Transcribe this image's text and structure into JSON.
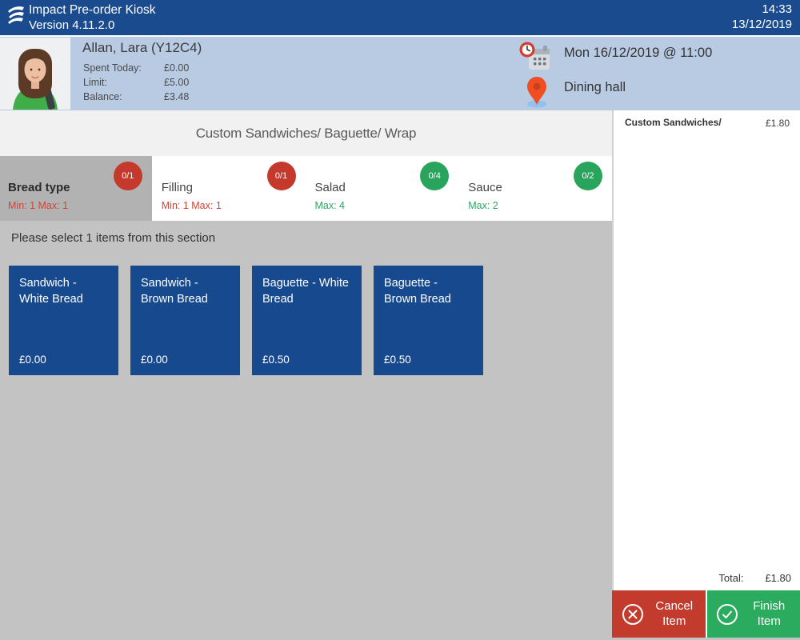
{
  "titlebar": {
    "app_title": "Impact Pre-order Kiosk",
    "version": "Version 4.11.2.0",
    "time": "14:33",
    "date": "13/12/2019"
  },
  "user": {
    "name": "Allan, Lara (Y12C4)",
    "stats": [
      {
        "label": "Spent Today:",
        "value": "£0.00"
      },
      {
        "label": "Limit:",
        "value": "£5.00"
      },
      {
        "label": "Balance:",
        "value": "£3.48"
      }
    ]
  },
  "session": {
    "datetime": "Mon 16/12/2019 @ 11:00",
    "location": "Dining hall"
  },
  "category_title": "Custom Sandwiches/ Baguette/ Wrap",
  "tabs": [
    {
      "label": "Bread type",
      "badge": "0/1",
      "constraint": "Min: 1 Max: 1",
      "status": "red",
      "selected": true
    },
    {
      "label": "Filling",
      "badge": "0/1",
      "constraint": "Min: 1 Max: 1",
      "status": "red",
      "selected": false
    },
    {
      "label": "Salad",
      "badge": "0/4",
      "constraint": "Max: 4",
      "status": "green",
      "selected": false
    },
    {
      "label": "Sauce",
      "badge": "0/2",
      "constraint": "Max: 2",
      "status": "green",
      "selected": false
    }
  ],
  "instruction": "Please select 1 items from this section",
  "items": [
    {
      "name": "Sandwich - White Bread",
      "price": "£0.00"
    },
    {
      "name": "Sandwich - Brown Bread",
      "price": "£0.00"
    },
    {
      "name": "Baguette - White Bread",
      "price": "£0.50"
    },
    {
      "name": "Baguette - Brown Bread",
      "price": "£0.50"
    }
  ],
  "order": {
    "line_item": "Custom Sandwiches/",
    "line_price": "£1.80",
    "total_label": "Total:",
    "total_value": "£1.80"
  },
  "actions": {
    "cancel_label": "Cancel Item",
    "finish_label": "Finish Item"
  },
  "colors": {
    "titlebar_blue": "#1a4b8f",
    "userbar_blue": "#b9cbe3",
    "tile_blue": "#17498f",
    "badge_red": "#c4392b",
    "badge_green": "#28a45c",
    "cancel_red": "#c23b2c",
    "finish_green": "#2bab5e"
  }
}
